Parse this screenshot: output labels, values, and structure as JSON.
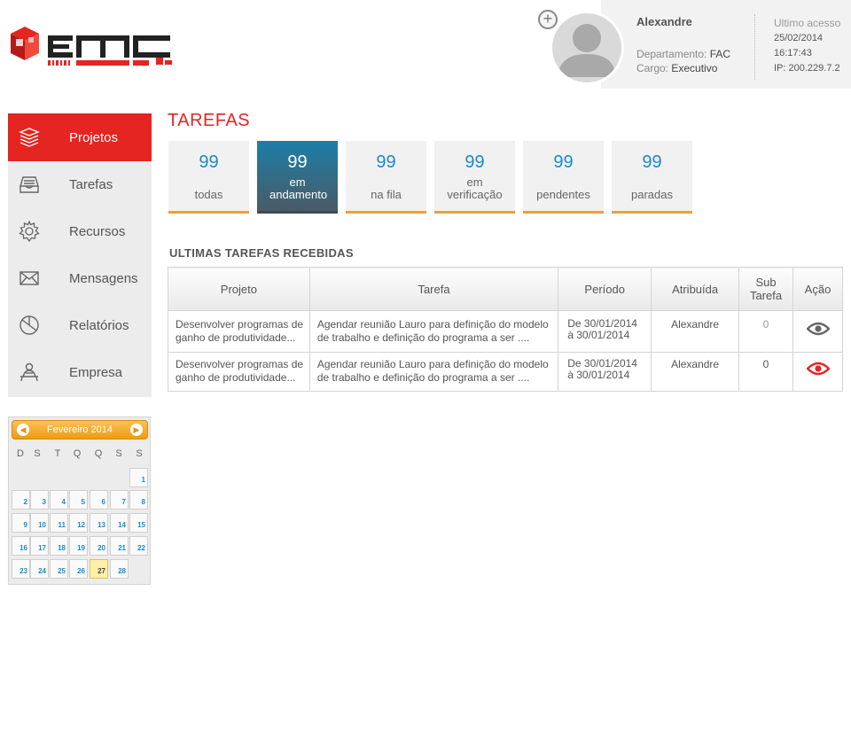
{
  "user": {
    "name": "Alexandre",
    "department_label": "Departamento:",
    "department_value": "FAC",
    "role_label": "Cargo:",
    "role_value": "Executivo",
    "last_access_label": "Ultimo acesso",
    "last_access_date": "25/02/2014",
    "last_access_time": "16:17:43",
    "ip": "IP: 200.229.7.2",
    "add_label": "+"
  },
  "sidebar": {
    "items": [
      {
        "label": "Projetos",
        "icon": "stack-icon",
        "active": true
      },
      {
        "label": "Tarefas",
        "icon": "inbox-tray-icon",
        "active": false
      },
      {
        "label": "Recursos",
        "icon": "gear-icon",
        "active": false
      },
      {
        "label": "Mensagens",
        "icon": "envelope-icon",
        "active": false
      },
      {
        "label": "Relatórios",
        "icon": "pie-chart-icon",
        "active": false
      },
      {
        "label": "Empresa",
        "icon": "person-desk-icon",
        "active": false
      }
    ]
  },
  "calendar": {
    "title": "Fevereiro 2014",
    "weekdays": [
      "D",
      "S",
      "T",
      "Q",
      "Q",
      "S",
      "S"
    ],
    "days": [
      "1",
      "2",
      "3",
      "4",
      "5",
      "6",
      "7",
      "8",
      "9",
      "10",
      "11",
      "12",
      "13",
      "14",
      "15",
      "16",
      "17",
      "18",
      "19",
      "20",
      "21",
      "22",
      "23",
      "24",
      "25",
      "26",
      "27",
      "28"
    ],
    "today": "27",
    "prev_label": "◀",
    "next_label": "▶"
  },
  "main": {
    "title": "TAREFAS",
    "stats": [
      {
        "value": "99",
        "label": "todas",
        "active": false
      },
      {
        "value": "99",
        "label": "em andamento",
        "active": true
      },
      {
        "value": "99",
        "label": "na fila",
        "active": false
      },
      {
        "value": "99",
        "label": "em verificação",
        "active": false
      },
      {
        "value": "99",
        "label": "pendentes",
        "active": false
      },
      {
        "value": "99",
        "label": "paradas",
        "active": false
      }
    ],
    "section_title": "ULTIMAS TAREFAS RECEBIDAS",
    "table": {
      "headers": [
        "Projeto",
        "Tarefa",
        "Período",
        "Atribuída",
        "Sub Tarefa",
        "Ação"
      ],
      "rows": [
        {
          "projeto": "Desenvolver programas de ganho de produtividade...",
          "tarefa": "Agendar reunião Lauro para definição do modelo de trabalho e definição do programa a ser ....",
          "periodo_1": "De 30/01/2014",
          "periodo_2": "à 30/01/2014",
          "atribuida": "Alexandre",
          "sub": "0",
          "acao_color": "#666666"
        },
        {
          "projeto": "Desenvolver programas de ganho de produtividade...",
          "tarefa": "Agendar reunião Lauro para definição do modelo de trabalho e definição do programa a ser ....",
          "periodo_1": "De 30/01/2014",
          "periodo_2": "à 30/01/2014",
          "atribuida": "Alexandre",
          "sub": "0",
          "acao_color": "#e52521"
        }
      ]
    }
  },
  "colors": {
    "brand_red": "#e52521",
    "accent_blue": "#1a8ac8",
    "accent_orange": "#f0a030"
  }
}
